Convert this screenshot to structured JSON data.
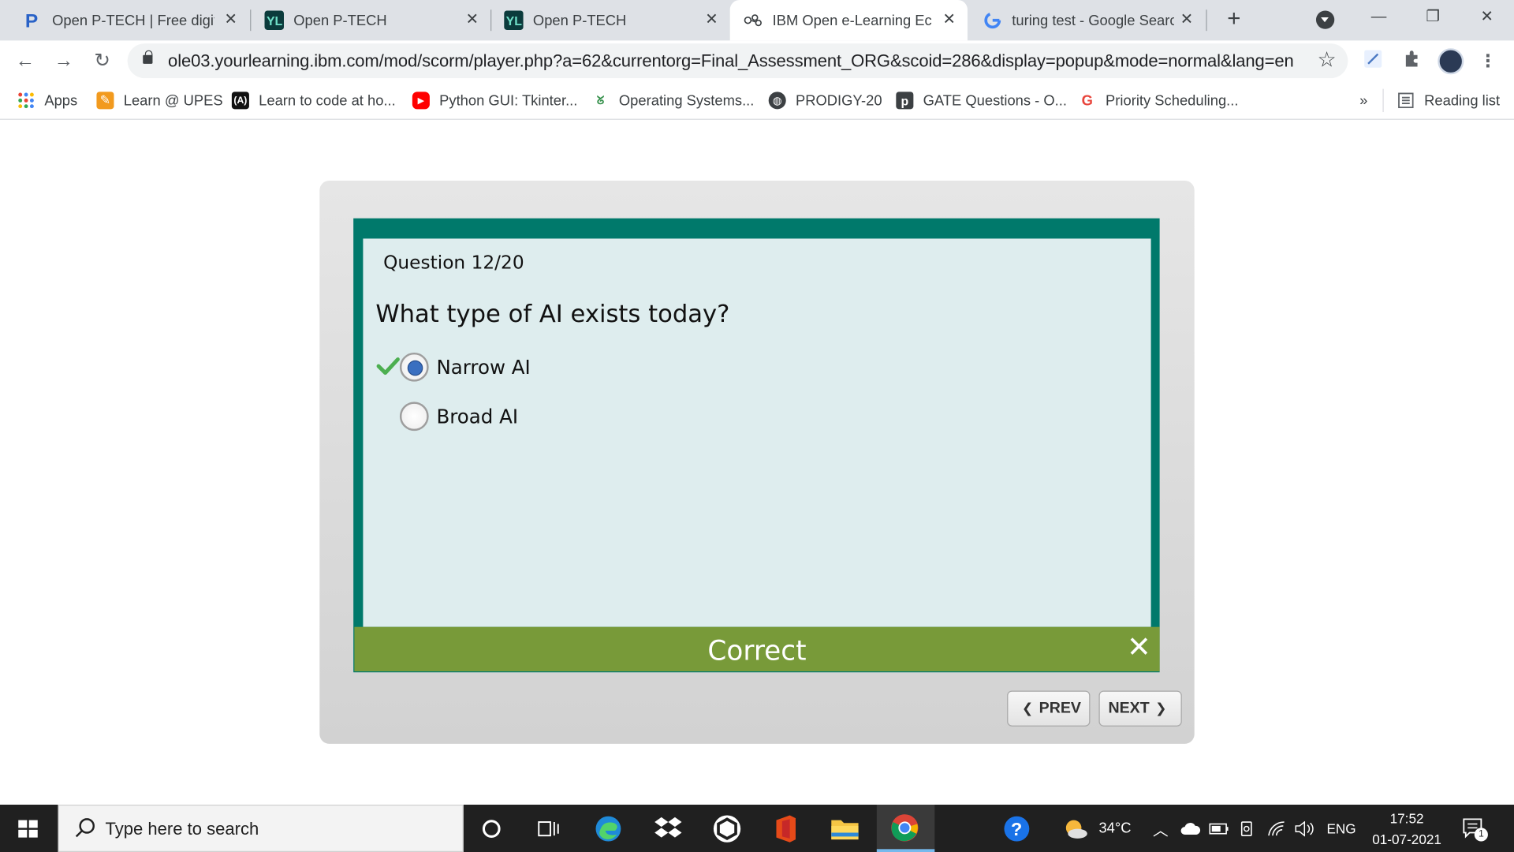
{
  "browser": {
    "tabs": [
      {
        "title": "Open P-TECH | Free digita",
        "active": false
      },
      {
        "title": "Open P-TECH",
        "active": false
      },
      {
        "title": "Open P-TECH",
        "active": false
      },
      {
        "title": "IBM Open e-Learning Eco",
        "active": true
      },
      {
        "title": "turing test - Google Searc",
        "active": false
      }
    ],
    "new_tab_label": "+",
    "window_controls": {
      "minimize": "—",
      "restore": "❐",
      "close": "✕"
    },
    "url": "ole03.yourlearning.ibm.com/mod/scorm/player.php?a=62&currentorg=Final_Assessment_ORG&scoid=286&display=popup&mode=normal&lang=en",
    "nav": {
      "back": "←",
      "forward": "→",
      "reload": "↻"
    },
    "bookmarks": [
      {
        "label": "Apps"
      },
      {
        "label": "Learn @ UPES"
      },
      {
        "label": "Learn to code at ho..."
      },
      {
        "label": "Python GUI: Tkinter..."
      },
      {
        "label": "Operating Systems..."
      },
      {
        "label": "PRODIGY-20"
      },
      {
        "label": "GATE Questions - O..."
      },
      {
        "label": "Priority Scheduling..."
      }
    ],
    "more_bookmarks": "»",
    "reading_list": "Reading list"
  },
  "quiz": {
    "question_number": "Question 12/20",
    "question": "What type of AI exists today?",
    "options": [
      {
        "label": "Narrow AI",
        "selected": true,
        "correct": true
      },
      {
        "label": "Broad AI",
        "selected": false,
        "correct": false
      }
    ],
    "feedback": "Correct",
    "prev_label": "PREV",
    "next_label": "NEXT"
  },
  "taskbar": {
    "search_placeholder": "Type here to search",
    "weather": "34°C",
    "language": "ENG",
    "time": "17:52",
    "date": "01-07-2021",
    "notification_count": "1"
  },
  "colors": {
    "frame": "#00796b",
    "panel": "#deedee",
    "feedback_bar": "#789a39",
    "radio_selected": "#3a6fc0"
  }
}
